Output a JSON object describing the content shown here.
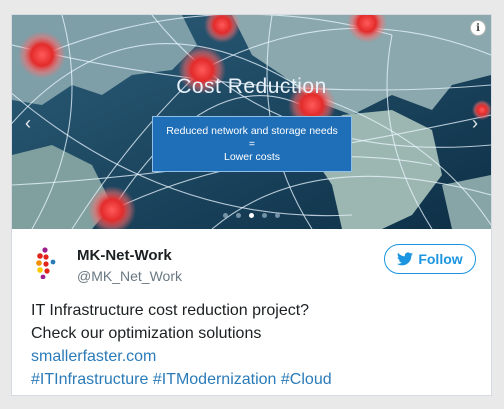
{
  "media": {
    "title": "Cost Reduction",
    "box_line1": "Reduced network and storage needs",
    "box_line2": "=",
    "box_line3": "Lower costs",
    "info_icon": "info-icon",
    "prev_icon": "chevron-left-icon",
    "next_icon": "chevron-right-icon",
    "slide_count": 5,
    "active_slide": 2
  },
  "author": {
    "name": "MK-Net-Work",
    "handle": "@MK_Net_Work",
    "avatar_icon": "mk-net-work-logo"
  },
  "follow": {
    "label": "Follow",
    "icon": "twitter-bird-icon",
    "color": "#1b95e0"
  },
  "tweet": {
    "line1": "IT Infrastructure cost reduction project?",
    "line2": "Check our optimization solutions",
    "link": "smallerfaster.com",
    "hashtags": [
      "#ITInfrastructure",
      "#ITModernization",
      "#Cloud"
    ]
  },
  "colors": {
    "link": "#2b7bb9",
    "text": "#1c2022",
    "muted": "#697882"
  }
}
